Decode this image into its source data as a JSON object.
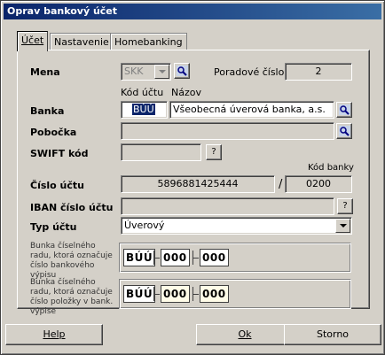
{
  "window": {
    "title": "Oprav bankový účet"
  },
  "tabs": [
    {
      "label": "Účet",
      "active": true
    },
    {
      "label": "Nastavenie",
      "active": false
    },
    {
      "label": "Homebanking",
      "active": false
    }
  ],
  "form": {
    "mena": {
      "label": "Mena",
      "value": "SKK"
    },
    "poradove": {
      "label": "Poradové číslo",
      "value": "2"
    },
    "kod_uctu_header": "Kód účtu",
    "nazov_header": "Názov",
    "banka": {
      "label": "Banka",
      "code": "BÚÚ",
      "name": "Všeobecná úverová banka, a.s."
    },
    "pobocka": {
      "label": "Pobočka",
      "value": ""
    },
    "swift": {
      "label": "SWIFT kód",
      "value": "",
      "help": "?"
    },
    "kod_banky_header": "Kód banky",
    "cislo_uctu": {
      "label": "Číslo účtu",
      "value": "5896881425444",
      "slash": "/",
      "bank_code": "0200"
    },
    "iban": {
      "label": "IBAN číslo účtu",
      "value": "",
      "help": "?"
    },
    "typ_uctu": {
      "label": "Typ účtu",
      "value": "Úverový"
    },
    "rad_vypis": {
      "label": "Bunka číselného radu, ktorá označuje číslo bankového výpisu",
      "seg1": "BÚÚ",
      "seg2": "000",
      "seg3": "000"
    },
    "rad_polozka": {
      "label": "Bunka číselného radu, ktorá označuje číslo položky v bank. výpise",
      "seg1": "BÚÚ",
      "seg2": "000",
      "seg3": "000"
    }
  },
  "buttons": {
    "help": "Help",
    "ok": "Ok",
    "storno": "Storno"
  },
  "icons": {
    "lookup": "magnifier-lookup-icon",
    "dropdown": "chevron-down-icon"
  }
}
